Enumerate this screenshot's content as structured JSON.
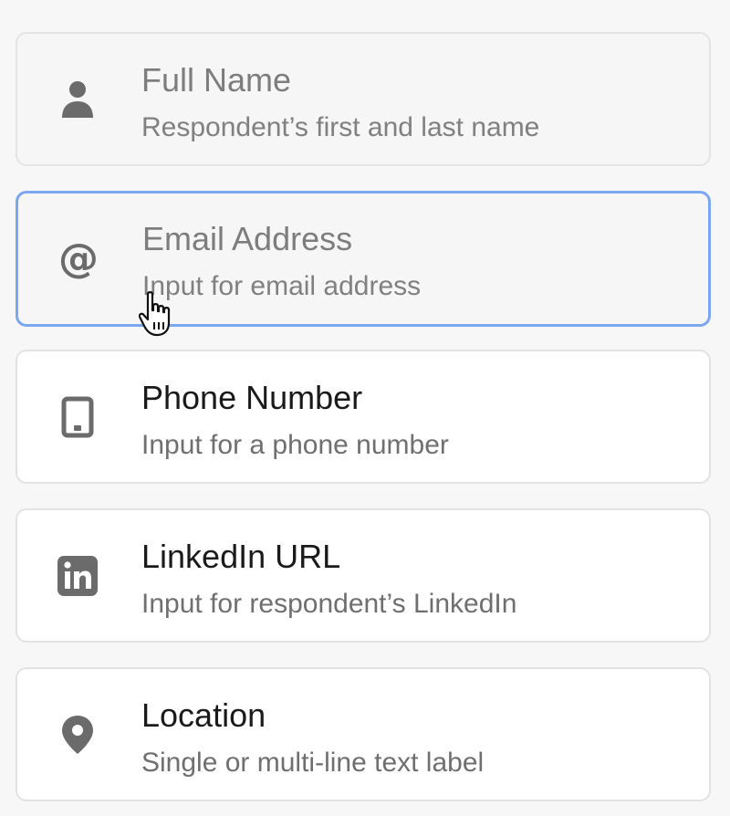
{
  "fields": [
    {
      "id": "full-name",
      "title": "Full Name",
      "description": "Respondent’s first and last name",
      "icon": "person-icon",
      "state": "used"
    },
    {
      "id": "email-address",
      "title": "Email Address",
      "description": "Input for email address",
      "icon": "at-sign-icon",
      "state": "hover"
    },
    {
      "id": "phone-number",
      "title": "Phone Number",
      "description": "Input for a phone number",
      "icon": "phone-icon",
      "state": "default"
    },
    {
      "id": "linkedin-url",
      "title": "LinkedIn URL",
      "description": "Input for respondent’s LinkedIn",
      "icon": "linkedin-icon",
      "state": "default"
    },
    {
      "id": "location",
      "title": "Location",
      "description": "Single or multi-line text label",
      "icon": "location-pin-icon",
      "state": "default"
    }
  ],
  "colors": {
    "hover_border": "#7aa7f0",
    "icon": "#6b6b6b",
    "title_active": "#1a1a1a",
    "title_muted": "#7d7d7d"
  },
  "cursor": "pointer-hand-icon"
}
